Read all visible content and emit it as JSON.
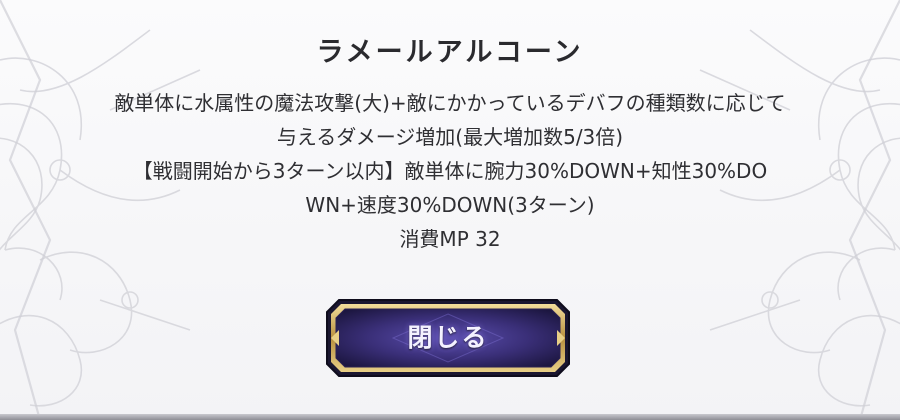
{
  "skill": {
    "name": "ラメールアルコーン",
    "description_lines": [
      "敵単体に水属性の魔法攻撃(大)+敵にかかっているデバフの種類数に応じて",
      "与えるダメージ増加(最大増加数5/3倍)",
      "【戦闘開始から3ターン以内】敵単体に腕力30%DOWN+知性30%DO",
      "WN+速度30%DOWN(3ターン)",
      "消費MP 32"
    ]
  },
  "close_button": {
    "label": "閉じる"
  },
  "colors": {
    "background": "#f6f6f8",
    "text": "#2f2f33",
    "button_fill": "#3a2f78",
    "button_frame": "#c8a85a"
  },
  "icons": {
    "left_ornament": "filigree-ornament-icon",
    "right_ornament": "filigree-ornament-icon"
  }
}
